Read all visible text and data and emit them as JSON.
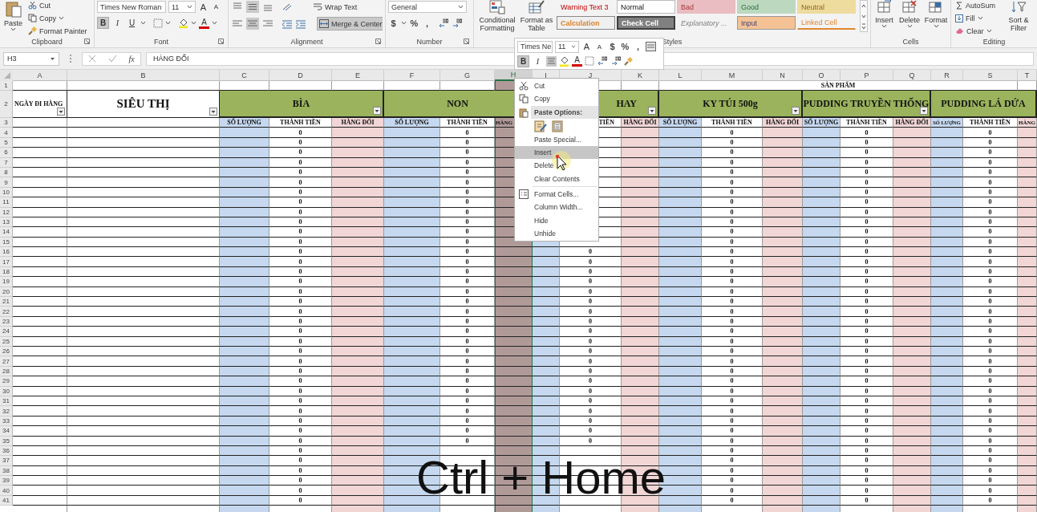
{
  "ribbon": {
    "clipboard": {
      "label": "Clipboard",
      "paste": "Paste",
      "cut": "Cut",
      "copy": "Copy",
      "format_painter": "Format Painter"
    },
    "font": {
      "label": "Font",
      "name": "Times New Roman",
      "size": "11",
      "grow": "A",
      "shrink": "A",
      "color_letter": "A",
      "styles": [
        {
          "label": "B",
          "selected": true
        },
        {
          "label": "I",
          "selected": false
        },
        {
          "label": "U",
          "selected": false
        }
      ]
    },
    "alignment": {
      "label": "Alignment",
      "wrap_text": "Wrap Text",
      "merge_center": "Merge & Center",
      "merge_selected": true,
      "vertical": [
        {
          "selected": false
        },
        {
          "selected": true
        },
        {
          "selected": false
        }
      ],
      "horizontal": [
        {
          "selected": false
        },
        {
          "selected": true
        },
        {
          "selected": false
        }
      ]
    },
    "number": {
      "label": "Number",
      "format": "General",
      "currency": "$",
      "percent": "%",
      "comma": ","
    },
    "styles": {
      "label": "Styles",
      "conditional": [
        "Conditional",
        "Formatting"
      ],
      "format_table": [
        "Format as",
        "Table"
      ],
      "gallery": [
        {
          "label": "Warning Text 3",
          "kind": "warning"
        },
        {
          "label": "Normal",
          "kind": "normal"
        },
        {
          "label": "Bad",
          "kind": "bad"
        },
        {
          "label": "Good",
          "kind": "good"
        },
        {
          "label": "Neutral",
          "kind": "neutral"
        },
        {
          "label": "Calculation",
          "kind": "calculation"
        },
        {
          "label": "Check Cell",
          "kind": "check"
        },
        {
          "label": "Explanatory ...",
          "kind": "explanatory"
        },
        {
          "label": "Input",
          "kind": "input"
        },
        {
          "label": "Linked Cell",
          "kind": "linked"
        }
      ]
    },
    "cells": {
      "label": "Cells",
      "buttons": [
        "Insert",
        "Delete",
        "Format"
      ]
    },
    "editing": {
      "label": "Editing",
      "autosum": "AutoSum",
      "fill": "Fill",
      "clear": "Clear",
      "sort": [
        "Sort &",
        "Filter"
      ]
    }
  },
  "formula_bar": {
    "name_box": "H3",
    "fx": "fx",
    "content": "HÀNG ĐỔI"
  },
  "mini_toolbar": {
    "font": "Times Ne",
    "size": "11",
    "grow": "A",
    "shrink": "A",
    "currency": "$",
    "percent": "%",
    "comma": ",",
    "color_letter": "A",
    "styles": [
      {
        "label": "B",
        "selected": true
      },
      {
        "label": "I",
        "selected": false
      }
    ],
    "center_selected": true
  },
  "sheet": {
    "columns": [
      {
        "letter": "A",
        "selected": false
      },
      {
        "letter": "B",
        "selected": false
      },
      {
        "letter": "C",
        "selected": false
      },
      {
        "letter": "D",
        "selected": false
      },
      {
        "letter": "E",
        "selected": false
      },
      {
        "letter": "F",
        "selected": false
      },
      {
        "letter": "G",
        "selected": false
      },
      {
        "letter": "H",
        "selected": true
      },
      {
        "letter": "I",
        "selected": false
      },
      {
        "letter": "J",
        "selected": false
      },
      {
        "letter": "K",
        "selected": false
      },
      {
        "letter": "L",
        "selected": false
      },
      {
        "letter": "M",
        "selected": false
      },
      {
        "letter": "N",
        "selected": false
      },
      {
        "letter": "O",
        "selected": false
      },
      {
        "letter": "P",
        "selected": false
      },
      {
        "letter": "Q",
        "selected": false
      },
      {
        "letter": "R",
        "selected": false
      },
      {
        "letter": "S",
        "selected": false
      },
      {
        "letter": "T",
        "selected": false
      }
    ],
    "title_row": {
      "n": "1",
      "title": "SẢN PHẨM"
    },
    "header_row": {
      "n": "2",
      "date": "NGÀY ĐI HÀNG",
      "store": "SIÊU THỊ"
    },
    "sub_row": {
      "n": "3"
    },
    "products": [
      {
        "name": "BÌA",
        "filter": true,
        "subheaders": {
          "qty": "SỐ LƯỢNG",
          "total": "THÀNH TIỀN",
          "returns": "HÀNG ĐỔI"
        }
      },
      {
        "name": "NON",
        "filter": false,
        "subheaders": {
          "qty": "SỐ LƯỢNG",
          "total": "THÀNH TIỀN",
          "returns": "HÀNG"
        }
      },
      {
        "name": "HAY",
        "filter": true,
        "subheaders": {
          "total": "TIỀN",
          "returns": "HÀNG ĐỔI"
        }
      },
      {
        "name": "KY TÚI 500g",
        "filter": true,
        "subheaders": {
          "qty": "SỐ LƯỢNG",
          "total": "THÀNH TIỀN",
          "returns": "HÀNG ĐỔI"
        }
      },
      {
        "name": "PUDDING TRUYỀN THỐNG",
        "filter": true,
        "subheaders": {
          "qty": "SỐ LƯỢNG",
          "total": "THÀNH TIỀN",
          "returns": "HÀNG ĐỔI"
        }
      },
      {
        "name": "PUDDING LÁ DỨA",
        "filter": false,
        "subheaders": {
          "qty": "SỐ LƯỢNG",
          "total": "THÀNH TIỀN",
          "returns": "HÀNG"
        }
      }
    ],
    "rows": [
      {
        "n": "4",
        "bia": "0",
        "non": "0",
        "ky_tui": "0",
        "truyen_thong": "0",
        "la_dua": "0"
      },
      {
        "n": "5",
        "bia": "0",
        "non": "0",
        "ky_tui": "0",
        "truyen_thong": "0",
        "la_dua": "0"
      },
      {
        "n": "6",
        "bia": "0",
        "non": "0",
        "ky_tui": "0",
        "truyen_thong": "0",
        "la_dua": "0"
      },
      {
        "n": "7",
        "bia": "0",
        "non": "0",
        "ky_tui": "0",
        "truyen_thong": "0",
        "la_dua": "0"
      },
      {
        "n": "8",
        "bia": "0",
        "non": "0",
        "ky_tui": "0",
        "truyen_thong": "0",
        "la_dua": "0"
      },
      {
        "n": "9",
        "bia": "0",
        "non": "0",
        "ky_tui": "0",
        "truyen_thong": "0",
        "la_dua": "0"
      },
      {
        "n": "10",
        "bia": "0",
        "non": "0",
        "ky_tui": "0",
        "truyen_thong": "0",
        "la_dua": "0"
      },
      {
        "n": "11",
        "bia": "0",
        "non": "0",
        "ky_tui": "0",
        "truyen_thong": "0",
        "la_dua": "0"
      },
      {
        "n": "12",
        "bia": "0",
        "non": "0",
        "ky_tui": "0",
        "truyen_thong": "0",
        "la_dua": "0"
      },
      {
        "n": "13",
        "bia": "0",
        "non": "0",
        "ky_tui": "0",
        "truyen_thong": "0",
        "la_dua": "0"
      },
      {
        "n": "14",
        "bia": "0",
        "non": "0",
        "ky_tui": "0",
        "truyen_thong": "0",
        "la_dua": "0"
      },
      {
        "n": "15",
        "bia": "0",
        "non": "0",
        "ky_tui": "0",
        "truyen_thong": "0",
        "la_dua": "0"
      },
      {
        "n": "16",
        "bia": "0",
        "non": "0",
        "hay": "0",
        "ky_tui": "0",
        "truyen_thong": "0",
        "la_dua": "0"
      },
      {
        "n": "17",
        "bia": "0",
        "non": "0",
        "hay": "0",
        "ky_tui": "0",
        "truyen_thong": "0",
        "la_dua": "0"
      },
      {
        "n": "18",
        "bia": "0",
        "non": "0",
        "hay": "0",
        "ky_tui": "0",
        "truyen_thong": "0",
        "la_dua": "0"
      },
      {
        "n": "19",
        "bia": "0",
        "non": "0",
        "hay": "0",
        "ky_tui": "0",
        "truyen_thong": "0",
        "la_dua": "0"
      },
      {
        "n": "20",
        "bia": "0",
        "non": "0",
        "hay": "0",
        "ky_tui": "0",
        "truyen_thong": "0",
        "la_dua": "0"
      },
      {
        "n": "21",
        "bia": "0",
        "non": "0",
        "hay": "0",
        "ky_tui": "0",
        "truyen_thong": "0",
        "la_dua": "0"
      },
      {
        "n": "22",
        "bia": "0",
        "non": "0",
        "hay": "0",
        "ky_tui": "0",
        "truyen_thong": "0",
        "la_dua": "0"
      },
      {
        "n": "23",
        "bia": "0",
        "non": "0",
        "hay": "0",
        "ky_tui": "0",
        "truyen_thong": "0",
        "la_dua": "0"
      },
      {
        "n": "24",
        "bia": "0",
        "non": "0",
        "hay": "0",
        "ky_tui": "0",
        "truyen_thong": "0",
        "la_dua": "0"
      },
      {
        "n": "25",
        "bia": "0",
        "non": "0",
        "hay": "0",
        "ky_tui": "0",
        "truyen_thong": "0",
        "la_dua": "0"
      },
      {
        "n": "26",
        "bia": "0",
        "non": "0",
        "hay": "0",
        "ky_tui": "0",
        "truyen_thong": "0",
        "la_dua": "0"
      },
      {
        "n": "27",
        "bia": "0",
        "non": "0",
        "hay": "0",
        "ky_tui": "0",
        "truyen_thong": "0",
        "la_dua": "0"
      },
      {
        "n": "28",
        "bia": "0",
        "non": "0",
        "hay": "0",
        "ky_tui": "0",
        "truyen_thong": "0",
        "la_dua": "0"
      },
      {
        "n": "29",
        "bia": "0",
        "non": "0",
        "hay": "0",
        "ky_tui": "0",
        "truyen_thong": "0",
        "la_dua": "0"
      },
      {
        "n": "30",
        "bia": "0",
        "non": "0",
        "hay": "0",
        "ky_tui": "0",
        "truyen_thong": "0",
        "la_dua": "0"
      },
      {
        "n": "31",
        "bia": "0",
        "non": "0",
        "hay": "0",
        "ky_tui": "0",
        "truyen_thong": "0",
        "la_dua": "0"
      },
      {
        "n": "32",
        "bia": "0",
        "non": "0",
        "hay": "0",
        "ky_tui": "0",
        "truyen_thong": "0",
        "la_dua": "0"
      },
      {
        "n": "33",
        "bia": "0",
        "non": "0",
        "hay": "0",
        "ky_tui": "0",
        "truyen_thong": "0",
        "la_dua": "0"
      },
      {
        "n": "34",
        "bia": "0",
        "non": "0",
        "hay": "0",
        "ky_tui": "0",
        "truyen_thong": "0",
        "la_dua": "0"
      },
      {
        "n": "35",
        "bia": "0",
        "non": "0",
        "hay": "0",
        "ky_tui": "0",
        "truyen_thong": "0",
        "la_dua": "0"
      },
      {
        "n": "36",
        "bia": "0",
        "ky_tui": "0",
        "truyen_thong": "0",
        "la_dua": "0"
      },
      {
        "n": "37",
        "bia": "0",
        "ky_tui": "0",
        "truyen_thong": "0",
        "la_dua": "0"
      },
      {
        "n": "38",
        "bia": "0",
        "ky_tui": "0",
        "truyen_thong": "0",
        "la_dua": "0"
      },
      {
        "n": "39",
        "bia": "0",
        "ky_tui": "0",
        "truyen_thong": "0",
        "la_dua": "0"
      },
      {
        "n": "40",
        "bia": "0",
        "ky_tui": "0",
        "truyen_thong": "0",
        "la_dua": "0"
      },
      {
        "n": "41",
        "bia": "0",
        "ky_tui": "0",
        "truyen_thong": "0",
        "la_dua": "0"
      }
    ]
  },
  "context_menu": [
    {
      "kind": "cut",
      "label": "Cut",
      "highlighted": false
    },
    {
      "kind": "copy",
      "label": "Copy",
      "highlighted": false
    },
    {
      "kind": "header",
      "label": "Paste Options:"
    },
    {
      "kind": "paste_icons"
    },
    {
      "kind": "item",
      "label": "Paste Special...",
      "highlighted": false
    },
    {
      "kind": "item",
      "label": "Insert",
      "highlighted": true
    },
    {
      "kind": "item",
      "label": "Delete",
      "highlighted": false
    },
    {
      "kind": "item",
      "label": "Clear Contents",
      "highlighted": false
    },
    {
      "kind": "separator"
    },
    {
      "kind": "format",
      "label": "Format Cells...",
      "highlighted": false
    },
    {
      "kind": "item",
      "label": "Column Width...",
      "highlighted": false
    },
    {
      "kind": "item",
      "label": "Hide",
      "highlighted": false
    },
    {
      "kind": "item",
      "label": "Unhide",
      "highlighted": false
    }
  ],
  "caption": "Ctrl + Home"
}
